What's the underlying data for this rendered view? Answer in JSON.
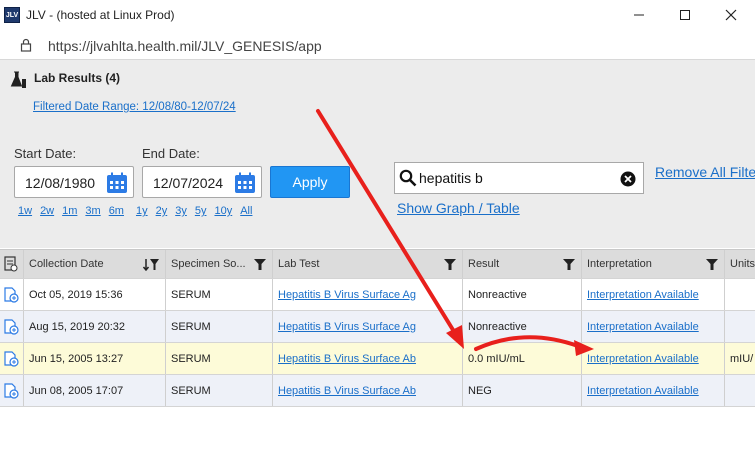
{
  "window": {
    "logo_text": "JLV",
    "title": "JLV - (hosted at Linux Prod)"
  },
  "address": {
    "url": "https://jlvahlta.health.mil/JLV_GENESIS/app"
  },
  "panel": {
    "title": "Lab Results (4)",
    "date_range_link": "Filtered Date Range: 12/08/80-12/07/24",
    "start_label": "Start Date:",
    "start_value": "12/08/1980",
    "end_label": "End Date:",
    "end_value": "12/07/2024",
    "apply_label": "Apply",
    "quick_ranges": [
      "1w",
      "2w",
      "1m",
      "3m",
      "6m",
      "1y",
      "2y",
      "3y",
      "5y",
      "10y",
      "All"
    ],
    "search_value": "hepatitis b",
    "remove_filters_label": "Remove All Filters",
    "graph_link": "Show Graph / Table"
  },
  "table": {
    "headers": [
      "Collection Date",
      "Specimen So...",
      "Lab Test",
      "Result",
      "Interpretation",
      "Units"
    ],
    "rows": [
      {
        "date": "Oct 05, 2019 15:36",
        "specimen": "SERUM",
        "test": "Hepatitis B Virus Surface Ag",
        "result": "Nonreactive",
        "interpretation": "Interpretation Available",
        "units": ""
      },
      {
        "date": "Aug 15, 2019 20:32",
        "specimen": "SERUM",
        "test": "Hepatitis B Virus Surface Ag",
        "result": "Nonreactive",
        "interpretation": "Interpretation Available",
        "units": ""
      },
      {
        "date": "Jun 15, 2005 13:27",
        "specimen": "SERUM",
        "test": "Hepatitis B Virus Surface Ab",
        "result": "0.0 mIU/mL",
        "interpretation": "Interpretation Available",
        "units": "mIU/"
      },
      {
        "date": "Jun 08, 2005 17:07",
        "specimen": "SERUM",
        "test": "Hepatitis B Virus Surface Ab",
        "result": "NEG",
        "interpretation": "Interpretation Available",
        "units": ""
      }
    ]
  },
  "colors": {
    "accent": "#2196f3",
    "link": "#1a6fc9",
    "highlight_row": "#fdfbd8",
    "annotation_arrow": "#e8201c"
  }
}
